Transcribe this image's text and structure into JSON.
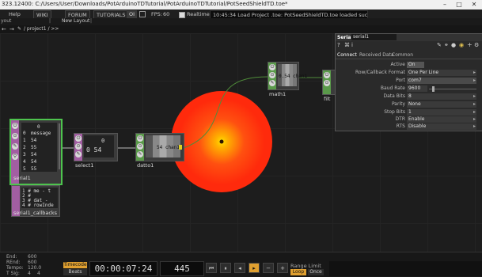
{
  "titlebar": {
    "title": "323.12400: C:/Users/User/Downloads/PotArduinoTDTutorial/PotArduinoTDTutorial/PotSeedShieldTD.toe*"
  },
  "menubar": {
    "items": [
      "Help",
      "WIKI",
      "FORUM",
      "TUTORIALS"
    ],
    "oi": "OI",
    "fps_label": "FPS:",
    "fps_value": "60",
    "realtime": "Realtime",
    "message": "10:45:34 Load Project .toe: PotSeedShieldTD.toe loaded successfully."
  },
  "tabs": {
    "left": "yout",
    "new_layout": "New Layout"
  },
  "path": "/ project1 / >>",
  "nodes": {
    "serial1": {
      "name": "serial1",
      "header": "0",
      "rows": [
        [
          "0",
          "message"
        ],
        [
          "1",
          "54"
        ],
        [
          "2",
          "55"
        ],
        [
          "3",
          "54"
        ],
        [
          "4",
          "54"
        ],
        [
          "5",
          "55"
        ]
      ]
    },
    "select1": {
      "name": "select1",
      "top": "0",
      "value": "0  54"
    },
    "datto1": {
      "name": "datto1",
      "value": "54 chan1"
    },
    "math1": {
      "name": "math1",
      "value": "0.54 chan1"
    },
    "filter": {
      "name": "filt"
    },
    "callbacks": {
      "name": "serial1_callbacks",
      "lines": [
        "1  # me - t",
        "2  #",
        "3  # dat - ",
        "4  # rowInde"
      ]
    }
  },
  "panel": {
    "type": "Serial",
    "name": "serial1",
    "tabs": [
      "Connect",
      "Received Data",
      "Common"
    ],
    "params": [
      {
        "label": "Active",
        "value": "On"
      },
      {
        "label": "Row/Callback Format",
        "value": "One Per Line"
      },
      {
        "label": "Port",
        "value": "com7"
      },
      {
        "label": "Baud Rate",
        "value": "9600"
      },
      {
        "label": "Data Bits",
        "value": "8"
      },
      {
        "label": "Parity",
        "value": "None"
      },
      {
        "label": "Stop Bits",
        "value": "1"
      },
      {
        "label": "DTR",
        "value": "Enable"
      },
      {
        "label": "RTS",
        "value": "Disable"
      }
    ]
  },
  "ruler": {
    "ticks": [
      "1",
      "51",
      "101",
      "151",
      "201",
      "251",
      "301",
      "351",
      "401",
      "451",
      "501",
      "551",
      "601"
    ]
  },
  "timeline": {
    "end_label": "End:",
    "end": "600",
    "rend_label": "REnd:",
    "rend": "600",
    "tempo_label": "Tempo:",
    "tempo": "120.0",
    "tsig_label": "T Sig:",
    "tsig": "4",
    "tsig_den": "4",
    "timecode_label": "Timecode",
    "beats_label": "Beats",
    "timecode": "00:00:07:24",
    "frame": "445",
    "range_limit": "Range Limit",
    "loop": "Loop",
    "once": "Once"
  },
  "colors": {
    "accent": "#f0a030",
    "glow": "#ff3a10",
    "purple": "#a25ea2",
    "green": "#5a9a4a"
  }
}
